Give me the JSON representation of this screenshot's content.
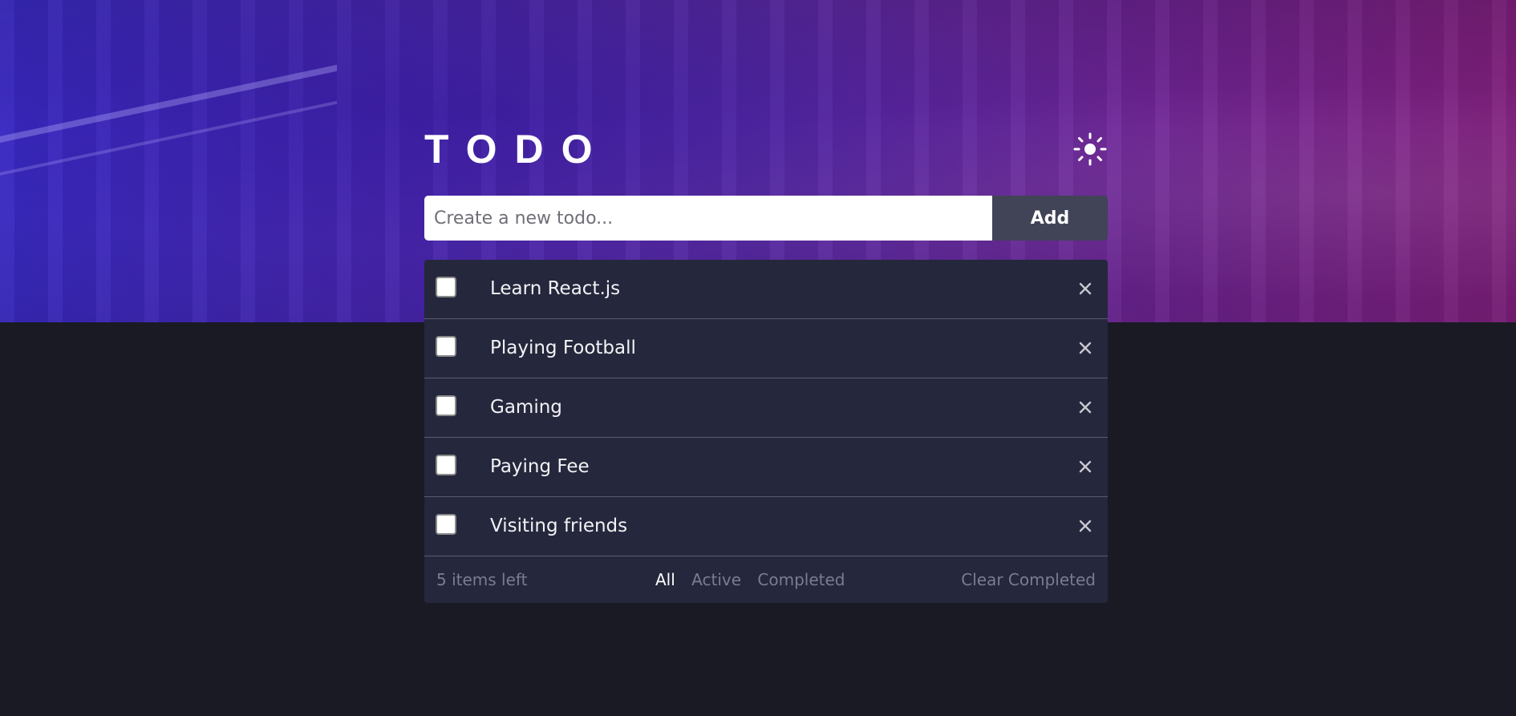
{
  "app": {
    "title": "TODO"
  },
  "header": {
    "theme_toggle_icon": "sun-icon"
  },
  "new_todo": {
    "placeholder": "Create a new todo...",
    "value": "",
    "add_label": "Add"
  },
  "todos": [
    {
      "text": "Learn React.js",
      "completed": false
    },
    {
      "text": "Playing Football",
      "completed": false
    },
    {
      "text": "Gaming",
      "completed": false
    },
    {
      "text": "Paying Fee",
      "completed": false
    },
    {
      "text": "Visiting friends",
      "completed": false
    }
  ],
  "footer": {
    "items_left": "5 items left",
    "filters": [
      "All",
      "Active",
      "Completed"
    ],
    "active_filter": "All",
    "clear_label": "Clear Completed"
  },
  "colors": {
    "hero_left": "#3b2bc9",
    "hero_right": "#82207f",
    "page_bg": "#191a23",
    "card_bg": "#25273c",
    "add_button_bg": "#404456",
    "muted_text": "#7a7c92"
  }
}
